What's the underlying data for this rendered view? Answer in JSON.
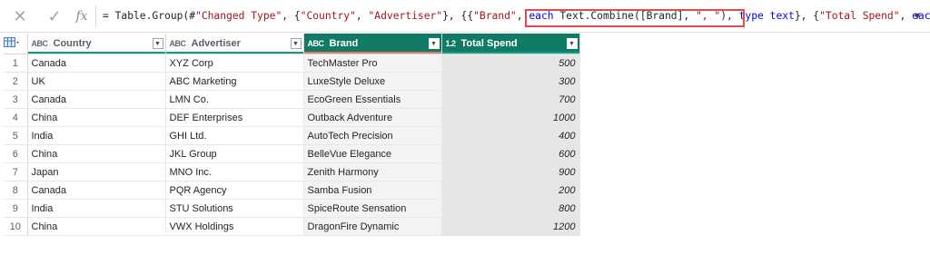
{
  "formula_bar": {
    "cancel_icon": "x-icon",
    "commit_icon": "check-icon",
    "fx_label": "fx",
    "formula_parts": [
      {
        "t": "= Table.Group(#",
        "c": ""
      },
      {
        "t": "\"Changed Type\"",
        "c": "str"
      },
      {
        "t": ", {",
        "c": ""
      },
      {
        "t": "\"Country\"",
        "c": "str"
      },
      {
        "t": ", ",
        "c": ""
      },
      {
        "t": "\"Advertiser\"",
        "c": "str"
      },
      {
        "t": "}, {{",
        "c": ""
      },
      {
        "t": "\"Brand\"",
        "c": "str"
      },
      {
        "t": ", ",
        "c": ""
      },
      {
        "t": "each",
        "c": "kw"
      },
      {
        "t": " Text.Combine([Brand], ",
        "c": ""
      },
      {
        "t": "\", \"",
        "c": "str"
      },
      {
        "t": "), ",
        "c": ""
      },
      {
        "t": "type",
        "c": "kw"
      },
      {
        "t": " ",
        "c": ""
      },
      {
        "t": "text",
        "c": "kw"
      },
      {
        "t": "}, {",
        "c": ""
      },
      {
        "t": "\"Total Spend\"",
        "c": "str"
      },
      {
        "t": ", ",
        "c": ""
      },
      {
        "t": "each",
        "c": "kw"
      }
    ],
    "expand_icon": "chevron-down-icon"
  },
  "table": {
    "columns": [
      {
        "type_icon": "ABC",
        "label": "Country"
      },
      {
        "type_icon": "ABC",
        "label": "Advertiser"
      },
      {
        "type_icon": "ABC",
        "label": "Brand"
      },
      {
        "type_icon": "1.2",
        "label": "Total Spend"
      }
    ],
    "rows": [
      {
        "n": "1",
        "country": "Canada",
        "advertiser": "XYZ Corp",
        "brand": "TechMaster Pro",
        "spend": "500"
      },
      {
        "n": "2",
        "country": "UK",
        "advertiser": "ABC Marketing",
        "brand": "LuxeStyle Deluxe",
        "spend": "300"
      },
      {
        "n": "3",
        "country": "Canada",
        "advertiser": "LMN Co.",
        "brand": "EcoGreen Essentials",
        "spend": "700"
      },
      {
        "n": "4",
        "country": "China",
        "advertiser": "DEF Enterprises",
        "brand": "Outback Adventure",
        "spend": "1000"
      },
      {
        "n": "5",
        "country": "India",
        "advertiser": "GHI Ltd.",
        "brand": "AutoTech Precision",
        "spend": "400"
      },
      {
        "n": "6",
        "country": "China",
        "advertiser": "JKL Group",
        "brand": "BelleVue Elegance",
        "spend": "600"
      },
      {
        "n": "7",
        "country": "Japan",
        "advertiser": "MNO Inc.",
        "brand": "Zenith Harmony",
        "spend": "900"
      },
      {
        "n": "8",
        "country": "Canada",
        "advertiser": "PQR Agency",
        "brand": "Samba Fusion",
        "spend": "200"
      },
      {
        "n": "9",
        "country": "India",
        "advertiser": "STU Solutions",
        "brand": "SpiceRoute Sensation",
        "spend": "800"
      },
      {
        "n": "10",
        "country": "China",
        "advertiser": "VWX Holdings",
        "brand": "DragonFire Dynamic",
        "spend": "1200"
      }
    ]
  },
  "colors": {
    "accent": "#107a64",
    "highlight_box": "#e24b4b",
    "column_bar": "#0e9f86",
    "selected_bar": "#e07b6a"
  }
}
